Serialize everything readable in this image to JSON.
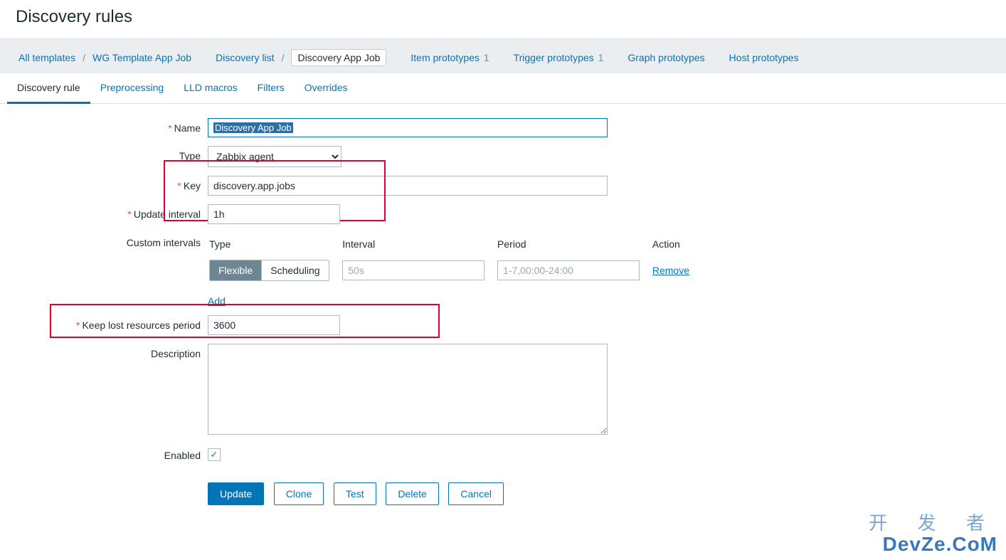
{
  "page_title": "Discovery rules",
  "breadcrumb": {
    "all_templates": "All templates",
    "template": "WG Template App Job",
    "discovery_list": "Discovery list",
    "current": "Discovery App Job",
    "item_proto": "Item prototypes",
    "item_proto_count": "1",
    "trigger_proto": "Trigger prototypes",
    "trigger_proto_count": "1",
    "graph_proto": "Graph prototypes",
    "host_proto": "Host prototypes"
  },
  "tabs": {
    "rule": "Discovery rule",
    "preproc": "Preprocessing",
    "lld": "LLD macros",
    "filters": "Filters",
    "overrides": "Overrides"
  },
  "labels": {
    "name": "Name",
    "type": "Type",
    "key": "Key",
    "update_interval": "Update interval",
    "custom_intervals": "Custom intervals",
    "keep_lost": "Keep lost resources period",
    "description": "Description",
    "enabled": "Enabled"
  },
  "fields": {
    "name": "Discovery App Job",
    "type": "Zabbix agent",
    "key": "discovery.app.jobs",
    "update_interval": "1h",
    "keep_lost": "3600",
    "description": "",
    "enabled": true
  },
  "intervals": {
    "header_type": "Type",
    "header_interval": "Interval",
    "header_period": "Period",
    "header_action": "Action",
    "flexible": "Flexible",
    "scheduling": "Scheduling",
    "interval_ph": "50s",
    "period_ph": "1-7,00:00-24:00",
    "remove": "Remove",
    "add": "Add"
  },
  "buttons": {
    "update": "Update",
    "clone": "Clone",
    "test": "Test",
    "delete": "Delete",
    "cancel": "Cancel"
  },
  "watermark": {
    "cn": "开 发 者",
    "en": "DevZe.CoM"
  }
}
